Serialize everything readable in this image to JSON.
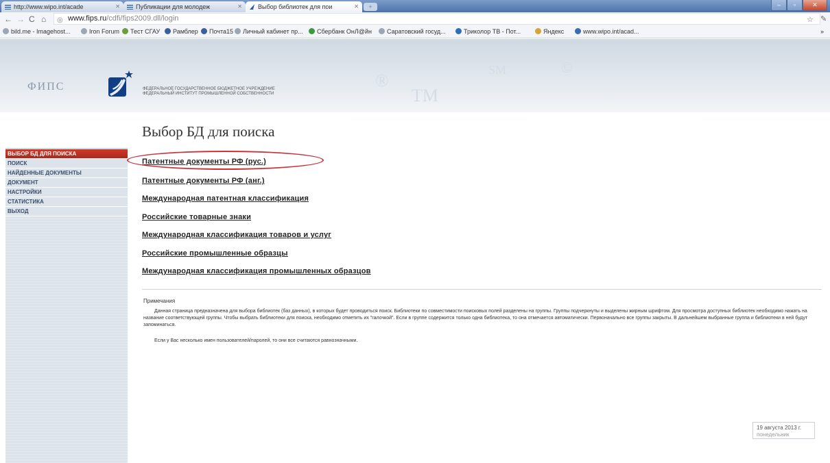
{
  "browser": {
    "tabs": [
      {
        "title": "http://www.wipo.int/acade"
      },
      {
        "title": "Публикации для молодеж"
      },
      {
        "title": "Выбор библиотек для пои"
      }
    ],
    "address": {
      "host": "www.fips.ru",
      "path": "/cdfi/fips2009.dll/login"
    },
    "bookmarks": [
      "bild.me - Imagehost...",
      "Iron Forum",
      "Тест СГАУ",
      "Рамблер",
      "Почта15",
      "Личный кабинет пр...",
      "Сбербанк ОнЛ@йн",
      "Саратовский госуд...",
      "Триколор ТВ - Пот...",
      "Яндекс",
      "www.wipo.int/acad..."
    ],
    "overflow": "»"
  },
  "header": {
    "logo_text": "ФИПС",
    "org_line1": "федеральное государственное бюджетное учреждение",
    "org_line2": "федеральный институт промышленной собственности",
    "watermarks": [
      "®",
      "TM",
      "SM",
      "©"
    ]
  },
  "page": {
    "title": "Выбор БД для поиска"
  },
  "sidebar": {
    "items": [
      {
        "label": "выбор БД для поиска"
      },
      {
        "label": "поиск"
      },
      {
        "label": "найденные документы"
      },
      {
        "label": "документ"
      },
      {
        "label": "настройки"
      },
      {
        "label": "статистика"
      },
      {
        "label": "выход"
      }
    ]
  },
  "databases": [
    "Патентные документы РФ (рус.)",
    "Патентные документы РФ (анг.)",
    "Международная патентная классификация",
    "Российские товарные знаки",
    "Международная классификация товаров и услуг",
    "Российские промышленные образцы",
    "Международная классификация промышленных образцов"
  ],
  "notes": {
    "title": "Примечания",
    "p1": "Данная страница предназначена для выбора библиотек (баз данных), в которых будет проводиться поиск. Библиотеки по совместимости поисковых полей разделены на группы. Группы подчеркнуты и выделены жирным шрифтом. Для просмотра доступных библиотек необходимо нажать на название соответствующей группы. Чтобы выбрать библиотеки для поиска, необходимо отметить их \"галочкой\". Если в группе содержится только одна библиотека, то она отмечается автоматически. Первоначально все группы закрыты. В дальнейшем выбранные группа и библиотеки в ней будут запоминаться.",
    "p2": "Если у Вас несколько имен пользователей/паролей, то они все считаются равнозначными."
  },
  "footer": {
    "date": "19 августа 2013 г.",
    "day": "понедельник"
  },
  "colors": {
    "accent": "#b8301f",
    "highlight_ellipse": "#c9343c"
  }
}
